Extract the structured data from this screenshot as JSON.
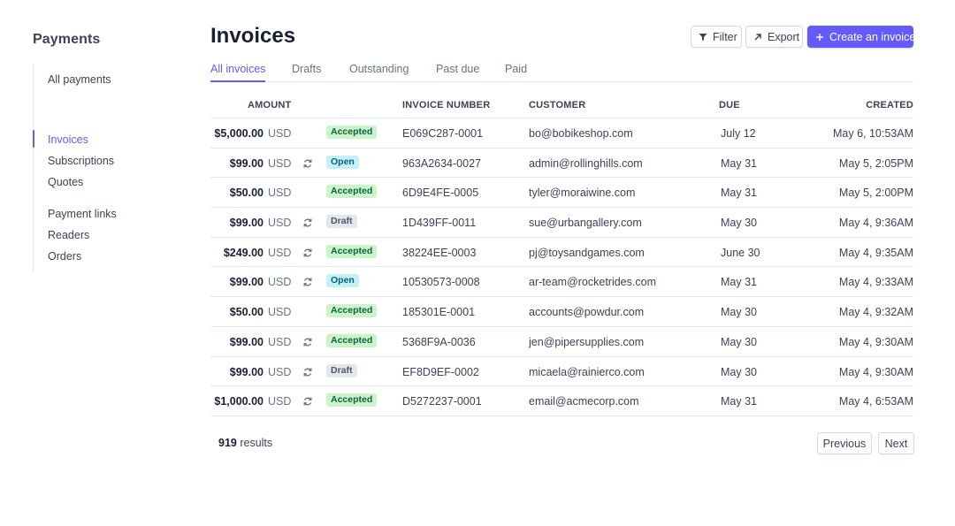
{
  "sidebar": {
    "title": "Payments",
    "items": [
      {
        "label": "All payments",
        "active": false
      },
      {
        "label": "Invoices",
        "active": true
      },
      {
        "label": "Subscriptions",
        "active": false
      },
      {
        "label": "Quotes",
        "active": false
      },
      {
        "label": "Payment links",
        "active": false
      },
      {
        "label": "Readers",
        "active": false
      },
      {
        "label": "Orders",
        "active": false
      }
    ]
  },
  "header": {
    "title": "Invoices",
    "filter_label": "Filter",
    "export_label": "Export",
    "create_label": "Create an invoice"
  },
  "tabs": [
    "All invoices",
    "Drafts",
    "Outstanding",
    "Past due",
    "Paid"
  ],
  "table": {
    "columns": {
      "amount": "AMOUNT",
      "invoice_number": "INVOICE NUMBER",
      "customer": "CUSTOMER",
      "due": "DUE",
      "created": "CREATED"
    },
    "rows": [
      {
        "amount": "$5,000.00",
        "currency": "USD",
        "recurring": false,
        "status": "Accepted",
        "number": "E069C287-0001",
        "customer": "bo@bobikeshop.com",
        "due": "July 12",
        "created": "May 6, 10:53AM"
      },
      {
        "amount": "$99.00",
        "currency": "USD",
        "recurring": true,
        "status": "Open",
        "number": "963A2634-0027",
        "customer": "admin@rollinghills.com",
        "due": "May 31",
        "created": "May 5, 2:05PM"
      },
      {
        "amount": "$50.00",
        "currency": "USD",
        "recurring": false,
        "status": "Accepted",
        "number": "6D9E4FE-0005",
        "customer": "tyler@moraiwine.com",
        "due": "May 31",
        "created": "May 5, 2:00PM"
      },
      {
        "amount": "$99.00",
        "currency": "USD",
        "recurring": true,
        "status": "Draft",
        "number": "1D439FF-0011",
        "customer": "sue@urbangallery.com",
        "due": "May 30",
        "created": "May 4, 9:36AM"
      },
      {
        "amount": "$249.00",
        "currency": "USD",
        "recurring": true,
        "status": "Accepted",
        "number": "38224EE-0003",
        "customer": "pj@toysandgames.com",
        "due": "June 30",
        "created": "May 4, 9:35AM"
      },
      {
        "amount": "$99.00",
        "currency": "USD",
        "recurring": true,
        "status": "Open",
        "number": "10530573-0008",
        "customer": "ar-team@rocketrides.com",
        "due": "May 31",
        "created": "May 4, 9:33AM"
      },
      {
        "amount": "$50.00",
        "currency": "USD",
        "recurring": false,
        "status": "Accepted",
        "number": "185301E-0001",
        "customer": "accounts@powdur.com",
        "due": "May 30",
        "created": "May 4, 9:32AM"
      },
      {
        "amount": "$99.00",
        "currency": "USD",
        "recurring": true,
        "status": "Accepted",
        "number": "5368F9A-0036",
        "customer": "jen@pipersupplies.com",
        "due": "May 30",
        "created": "May 4, 9:30AM"
      },
      {
        "amount": "$99.00",
        "currency": "USD",
        "recurring": true,
        "status": "Draft",
        "number": "EF8D9EF-0002",
        "customer": "micaela@rainierco.com",
        "due": "May 30",
        "created": "May 4, 9:30AM"
      },
      {
        "amount": "$1,000.00",
        "currency": "USD",
        "recurring": true,
        "status": "Accepted",
        "number": "D5272237-0001",
        "customer": "email@acmecorp.com",
        "due": "May 31",
        "created": "May 4, 6:53AM"
      }
    ]
  },
  "footer": {
    "results_count": "919",
    "results_label": "results",
    "previous_label": "Previous",
    "next_label": "Next"
  },
  "colors": {
    "accent": "#635bff",
    "accepted_bg": "#cbf4c9",
    "open_bg": "#c4f1f9",
    "draft_bg": "#e3e8ee"
  }
}
